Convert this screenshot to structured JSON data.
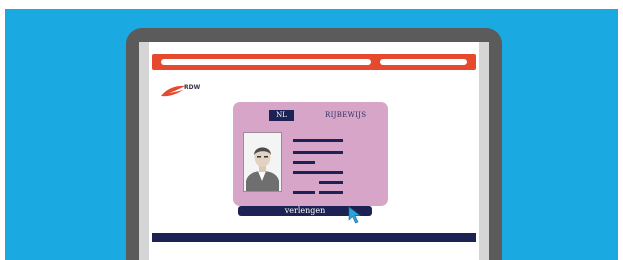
{
  "brand": {
    "logo_text": "RDW",
    "logo_icon": "rdw-wing-logo-icon"
  },
  "license": {
    "country_code": "NL",
    "document_title": "RIJBEWIJS",
    "photo_icon": "person-portrait-icon"
  },
  "action": {
    "renew_label": "verlengen",
    "cursor_icon": "mouse-pointer-icon"
  },
  "colors": {
    "background": "#1aa9e1",
    "laptop_bezel": "#5b5b5b",
    "screen_side_panel": "#d5d5d5",
    "brand_red": "#e54a2f",
    "card_pink": "#d7a5c8",
    "navy": "#1d2254",
    "cursor_blue": "#29a3d8"
  }
}
